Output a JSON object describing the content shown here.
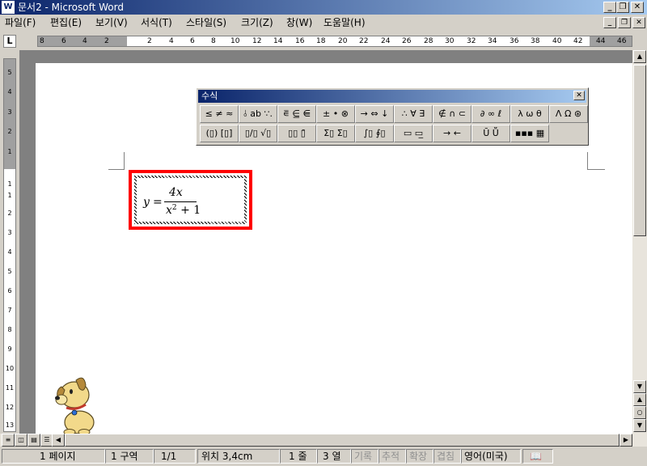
{
  "window": {
    "title": "문서2 - Microsoft Word",
    "app_icon": "word-icon"
  },
  "menu": {
    "items": [
      "파일(F)",
      "편집(E)",
      "보기(V)",
      "서식(T)",
      "스타일(S)",
      "크기(Z)",
      "창(W)",
      "도움말(H)"
    ]
  },
  "ruler": {
    "tab_selector": "L",
    "h_labels": [
      "8",
      "6",
      "4",
      "2",
      "2",
      "4",
      "6",
      "8",
      "10",
      "12",
      "14",
      "16",
      "18",
      "20",
      "22",
      "24",
      "26",
      "28",
      "30",
      "32",
      "34",
      "36",
      "38",
      "40",
      "42",
      "44",
      "46"
    ],
    "v_labels": [
      "5",
      "4",
      "3",
      "2",
      "1",
      "1",
      "1",
      "2",
      "3",
      "4",
      "5",
      "6",
      "7",
      "8",
      "9",
      "10",
      "11",
      "12",
      "13"
    ]
  },
  "equation_toolbar": {
    "title": "수식",
    "row1": [
      "≤ ≠ ≈",
      "⫰ ab ∵.",
      "⋷ ⋸ ⋹",
      "± • ⊗",
      "→ ⇔ ↓",
      "∴ ∀ ∃",
      "∉ ∩ ⊂",
      "∂ ∞ ℓ",
      "λ ω θ",
      "Λ Ω ⊛"
    ],
    "row2": [
      "(▯) [▯]",
      "▯/▯ √▯",
      "▯▯ ▯̄",
      "Σ▯ Σ▯",
      "∫▯ ∮▯",
      "▭ ▭̲",
      "→ ←",
      "Ū Ṻ",
      "▪▪▪ ▦"
    ]
  },
  "equation": {
    "lhs": "y",
    "equals": "=",
    "numerator": "4x",
    "den_base": "x",
    "den_exp": "2",
    "den_rest": " + 1"
  },
  "statusbar": {
    "page": "1 페이지",
    "section": "1 구역",
    "pages": "1/1",
    "position": "위치 3,4cm",
    "line": "1 줄",
    "column": "3 열",
    "rec": "기록",
    "trk": "추적",
    "ext": "확장",
    "ovr": "겹침",
    "language": "영어(미국)"
  }
}
